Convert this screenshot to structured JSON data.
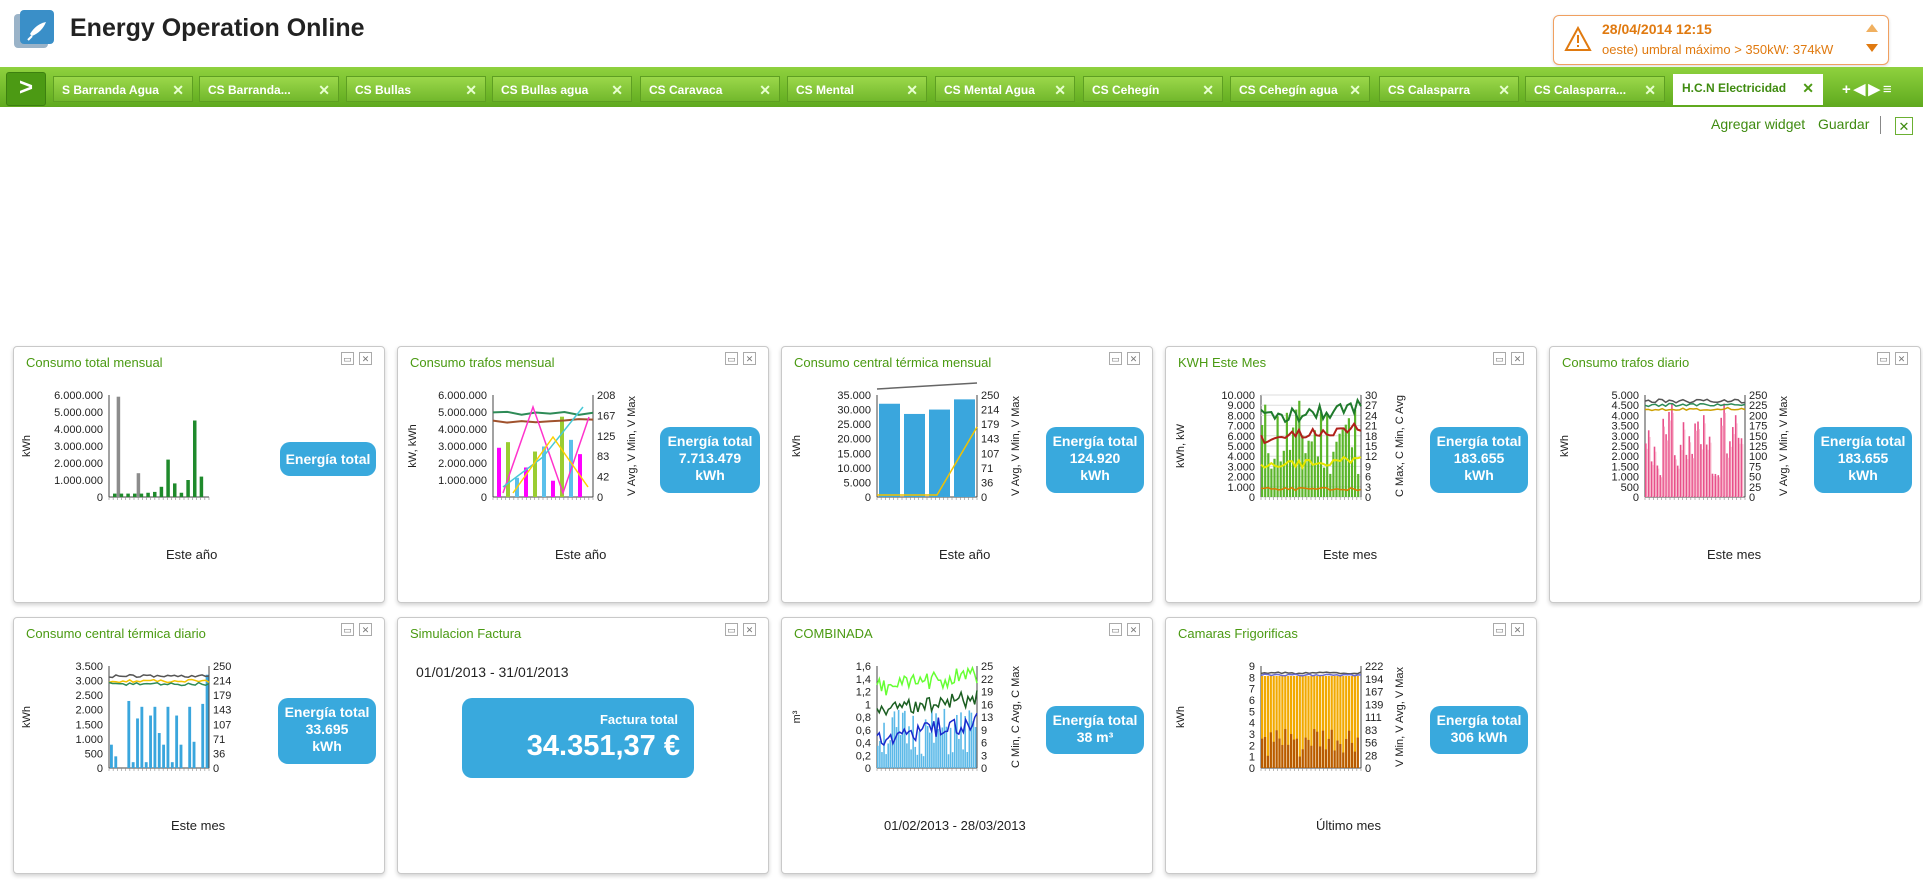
{
  "app": {
    "title": "Energy Operation Online"
  },
  "alert": {
    "date": "28/04/2014 12:15",
    "message": "oeste)  umbral máximo > 350kW: 374kW"
  },
  "tabs": [
    {
      "label": "S Barranda Agua"
    },
    {
      "label": "CS Barranda..."
    },
    {
      "label": "CS Bullas"
    },
    {
      "label": "CS Bullas agua"
    },
    {
      "label": "CS Caravaca"
    },
    {
      "label": "CS Mental"
    },
    {
      "label": "CS Mental Agua"
    },
    {
      "label": "CS Cehegín"
    },
    {
      "label": "CS Cehegín agua"
    },
    {
      "label": "CS Calasparra"
    },
    {
      "label": "CS Calasparra..."
    },
    {
      "label": "H.C.N Electricidad",
      "active": true
    }
  ],
  "toolbar": {
    "add_widget": "Agregar widget",
    "save": "Guardar"
  },
  "widgets": {
    "w1": {
      "title": "Consumo total mensual",
      "period": "Este año",
      "bubble": [
        "Energía total"
      ]
    },
    "w2": {
      "title": "Consumo trafos mensual",
      "period": "Este año",
      "bubble": [
        "Energía total",
        "7.713.479",
        "kWh"
      ]
    },
    "w3": {
      "title": "Consumo central térmica mensual",
      "period": "Este año",
      "bubble": [
        "Energía total",
        "124.920",
        "kWh"
      ]
    },
    "w4": {
      "title": "KWH Este Mes",
      "period": "Este mes",
      "bubble": [
        "Energía total",
        "183.655",
        "kWh"
      ]
    },
    "w5": {
      "title": "Consumo trafos diario",
      "period": "Este mes",
      "bubble": [
        "Energía total",
        "183.655",
        "kWh"
      ]
    },
    "w6": {
      "title": "Consumo central térmica diario",
      "period": "Este mes",
      "bubble": [
        "Energía total",
        "33.695",
        "kWh"
      ]
    },
    "w7": {
      "title": "Simulacion Factura",
      "range": "01/01/2013 - 31/01/2013",
      "total_label": "Factura total",
      "total_value": "34.351,37 €"
    },
    "w8": {
      "title": "COMBINADA",
      "period": "01/02/2013 - 28/03/2013",
      "bubble": [
        "Energía total",
        "38 m³"
      ]
    },
    "w9": {
      "title": "Camaras Frigorificas",
      "period": "Último mes",
      "bubble": [
        "Energía total",
        "306 kWh"
      ]
    }
  },
  "chart_data": [
    {
      "id": "w1",
      "type": "bar",
      "ylabel": "kWh",
      "yticks": [
        "6.000.000",
        "5.000.000",
        "4.000.000",
        "3.000.000",
        "2.000.000",
        "1.000.000",
        "0"
      ],
      "ylim": [
        0,
        6000000
      ],
      "series": [
        {
          "color": "#8c8c8c",
          "values": [
            0,
            5900000,
            0,
            0,
            1400000,
            0,
            0,
            0,
            0,
            0,
            0,
            0,
            0,
            0,
            0
          ]
        },
        {
          "color": "#1f8a2c",
          "values": [
            200000,
            200000,
            200000,
            200000,
            200000,
            250000,
            300000,
            600000,
            2200000,
            800000,
            250000,
            1000000,
            4500000,
            1200000,
            0
          ]
        }
      ]
    },
    {
      "id": "w2",
      "type": "line",
      "ylabel": "kW, kWh",
      "y2label": "V Avg, V Min, V Max",
      "yticks": [
        "6.000.000",
        "5.000.000",
        "4.000.000",
        "3.000.000",
        "2.000.000",
        "1.000.000",
        "0"
      ],
      "y2ticks": [
        "208",
        "167",
        "125",
        "83",
        "42",
        "0"
      ]
    },
    {
      "id": "w3",
      "type": "bar",
      "ylabel": "kWh",
      "y2label": "V Avg, V Min, V Max",
      "yticks": [
        "35.000",
        "30.000",
        "25.000",
        "20.000",
        "15.000",
        "10.000",
        "5.000",
        "0"
      ],
      "ylim": [
        0,
        35000
      ],
      "y2ticks": [
        "250",
        "214",
        "179",
        "143",
        "107",
        "71",
        "36",
        "0"
      ],
      "values": [
        32000,
        28500,
        30000,
        33500
      ]
    },
    {
      "id": "w4",
      "type": "bar",
      "ylabel": "kWh, kW",
      "y2label": "C Max, C Min, C Avg",
      "yticks": [
        "10.000",
        "9.000",
        "8.000",
        "7.000",
        "6.000",
        "5.000",
        "4.000",
        "3.000",
        "2.000",
        "1.000",
        "0"
      ],
      "y2ticks": [
        "30",
        "27",
        "24",
        "21",
        "18",
        "15",
        "12",
        "9",
        "6",
        "3",
        "0"
      ]
    },
    {
      "id": "w5",
      "type": "bar",
      "ylabel": "kWh",
      "y2label": "V Avg, V Min, V Max",
      "yticks": [
        "5.000",
        "4.500",
        "4.000",
        "3.500",
        "3.000",
        "2.500",
        "2.000",
        "1.500",
        "1.000",
        "500",
        "0"
      ],
      "y2ticks": [
        "250",
        "225",
        "200",
        "175",
        "150",
        "125",
        "100",
        "75",
        "50",
        "25",
        "0"
      ]
    },
    {
      "id": "w6",
      "type": "bar",
      "ylabel": "kWh",
      "yticks": [
        "3.500",
        "3.000",
        "2.500",
        "2.000",
        "1.500",
        "1.000",
        "500",
        "0"
      ],
      "ylim": [
        0,
        3500
      ],
      "y2ticks": [
        "250",
        "214",
        "179",
        "143",
        "107",
        "71",
        "36",
        "0"
      ],
      "values": [
        800,
        400,
        0,
        0,
        2300,
        200,
        1700,
        2100,
        200,
        1800,
        2100,
        1200,
        800,
        2100,
        200,
        1800,
        800,
        0,
        2100,
        900,
        0,
        2200,
        3200
      ]
    },
    {
      "id": "w8",
      "type": "line",
      "ylabel": "m³",
      "y2label": "C Min, C Avg, C Max",
      "yticks": [
        "1,6",
        "1,4",
        "1,2",
        "1",
        "0,8",
        "0,6",
        "0,4",
        "0,2",
        "0"
      ],
      "y2ticks": [
        "25",
        "22",
        "19",
        "16",
        "13",
        "9",
        "6",
        "3",
        "0"
      ]
    },
    {
      "id": "w9",
      "type": "bar",
      "ylabel": "kWh",
      "y2label": "V Min, V Avg, V Max",
      "yticks": [
        "9",
        "8",
        "7",
        "6",
        "5",
        "4",
        "3",
        "2",
        "1",
        "0"
      ],
      "y2ticks": [
        "222",
        "194",
        "167",
        "139",
        "111",
        "83",
        "56",
        "28",
        "0"
      ]
    }
  ]
}
